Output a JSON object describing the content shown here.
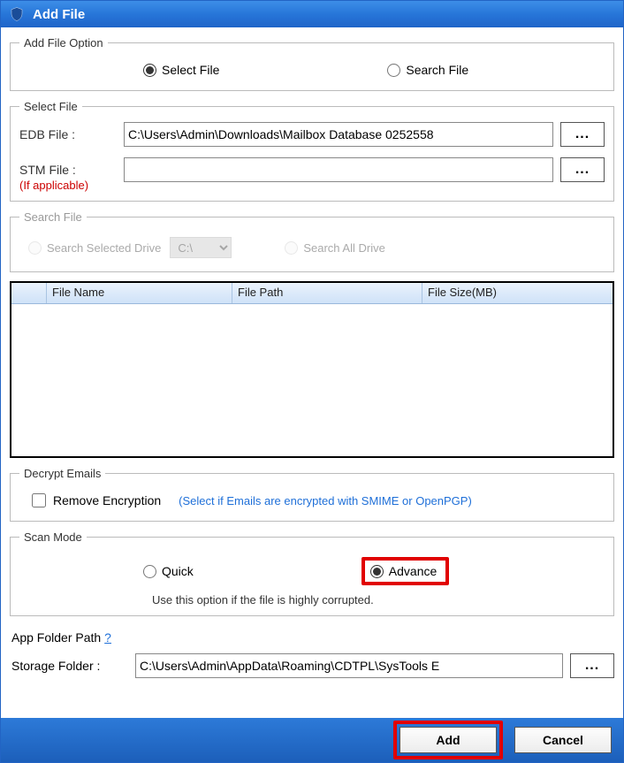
{
  "titlebar": {
    "title": "Add File"
  },
  "addFileOption": {
    "legend": "Add File Option",
    "selectFileLabel": "Select File",
    "searchFileLabel": "Search File"
  },
  "selectFile": {
    "legend": "Select File",
    "edbLabel": "EDB File :",
    "edbValue": "C:\\Users\\Admin\\Downloads\\Mailbox Database 0252558",
    "stmLabel": "STM File :",
    "stmValue": "",
    "note": "(If applicable)",
    "browseLabel": "..."
  },
  "searchFile": {
    "legend": "Search File",
    "searchSelectedDriveLabel": "Search Selected Drive",
    "driveValue": "C:\\",
    "searchAllDriveLabel": "Search All Drive"
  },
  "table": {
    "col1": "File Name",
    "col2": "File Path",
    "col3": "File Size(MB)"
  },
  "decrypt": {
    "legend": "Decrypt Emails",
    "removeEncryptionLabel": "Remove Encryption",
    "hint": "(Select if Emails are encrypted with SMIME or OpenPGP)"
  },
  "scanMode": {
    "legend": "Scan Mode",
    "quickLabel": "Quick",
    "advanceLabel": "Advance",
    "hint": "Use this option if the file is highly corrupted."
  },
  "appFolder": {
    "label": "App Folder Path",
    "help": "?",
    "storageLabel": "Storage Folder   :",
    "storageValue": "C:\\Users\\Admin\\AppData\\Roaming\\CDTPL\\SysTools E",
    "browseLabel": "..."
  },
  "footer": {
    "addLabel": "Add",
    "cancelLabel": "Cancel"
  }
}
